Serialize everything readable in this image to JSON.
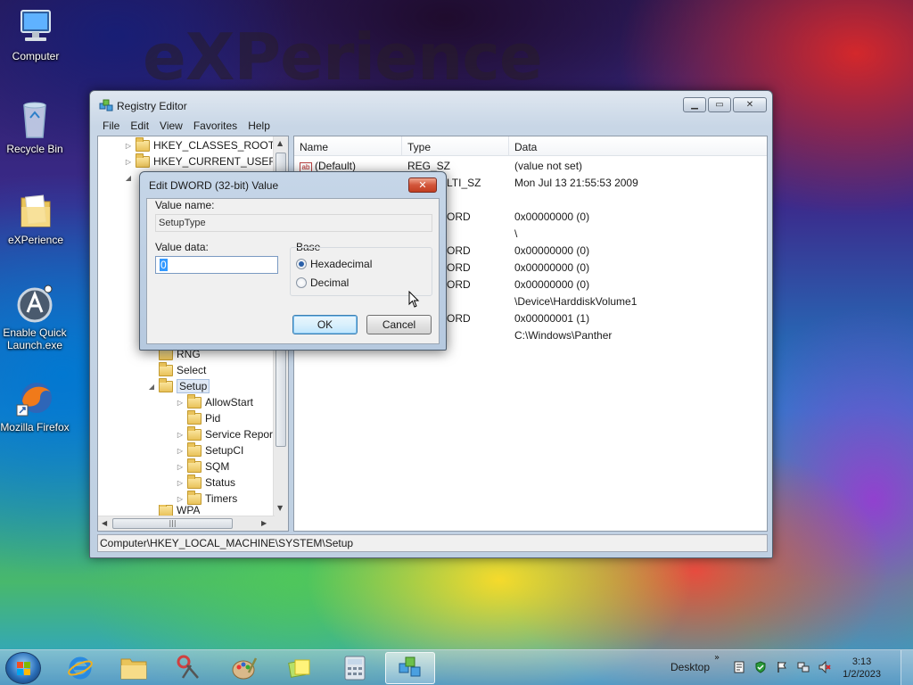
{
  "desktop": {
    "watermark": "eXPerience",
    "icons": [
      {
        "label": "Computer"
      },
      {
        "label": "Recycle Bin"
      },
      {
        "label": "eXPerience"
      },
      {
        "label": "Enable Quick Launch.exe"
      },
      {
        "label": "Mozilla Firefox"
      }
    ]
  },
  "window": {
    "title": "Registry Editor",
    "menu": [
      "File",
      "Edit",
      "View",
      "Favorites",
      "Help"
    ],
    "tree": [
      {
        "label": "HKEY_CLASSES_ROOT"
      },
      {
        "label": "HKEY_CURRENT_USER"
      },
      {
        "label": "RNG"
      },
      {
        "label": "Select"
      },
      {
        "label": "Setup"
      },
      {
        "label": "AllowStart"
      },
      {
        "label": "Pid"
      },
      {
        "label": "Service Report"
      },
      {
        "label": "SetupCI"
      },
      {
        "label": "SQM"
      },
      {
        "label": "Status"
      },
      {
        "label": "Timers"
      },
      {
        "label": "WPA"
      }
    ],
    "columns": {
      "name": "Name",
      "type": "Type",
      "data": "Data"
    },
    "rows": [
      {
        "name": "(Default)",
        "type": "REG_SZ",
        "data": "(value not set)"
      },
      {
        "type": "LTI_SZ",
        "data": "Mon Jul 13 21:55:53 2009"
      },
      {
        "type": "ORD",
        "data": "0x00000000 (0)"
      },
      {
        "data": "\\"
      },
      {
        "type": "ORD",
        "data": "0x00000000 (0)"
      },
      {
        "type": "ORD",
        "data": "0x00000000 (0)"
      },
      {
        "type": "ORD",
        "data": "0x00000000 (0)"
      },
      {
        "data": "\\Device\\HarddiskVolume1"
      },
      {
        "type": "ORD",
        "data": "0x00000001 (1)"
      },
      {
        "data": "C:\\Windows\\Panther"
      }
    ],
    "status": "Computer\\HKEY_LOCAL_MACHINE\\SYSTEM\\Setup"
  },
  "dialog": {
    "title": "Edit DWORD (32-bit) Value",
    "value_name_label": "Value name:",
    "value_name": "SetupType",
    "value_data_label": "Value data:",
    "value_data": "0",
    "base_label": "Base",
    "hex_label": "Hexadecimal",
    "dec_label": "Decimal",
    "ok": "OK",
    "cancel": "Cancel"
  },
  "taskbar": {
    "desktop_label": "Desktop",
    "time": "3:13",
    "date": "1/2/2023"
  }
}
